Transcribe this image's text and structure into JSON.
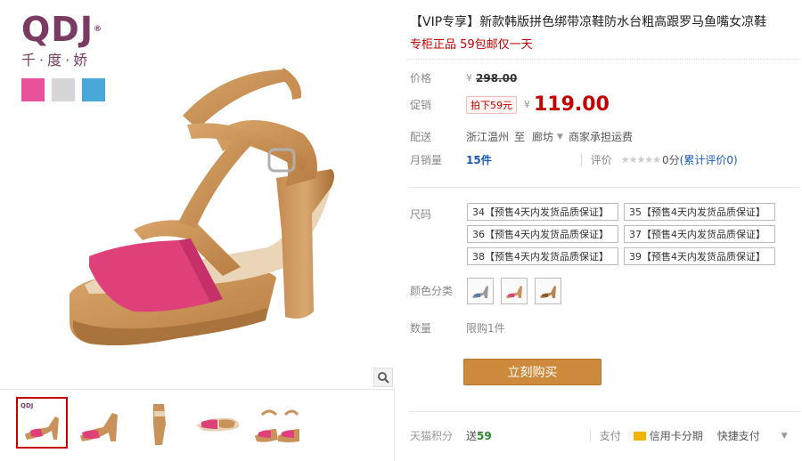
{
  "brand": {
    "logo": "QDJ",
    "reg_mark": "®",
    "tagline": "千·度·娇",
    "swatch_colors": [
      "#e8529a",
      "#d6d6d6",
      "#4aa8d8"
    ]
  },
  "gallery": {
    "zoom_icon": "magnifier-icon",
    "thumbnail_count": 5
  },
  "product": {
    "title": "【VIP专享】新款韩版拼色绑带凉鞋防水台粗高跟罗马鱼嘴女凉鞋",
    "subtitle": "专柜正品 59包邮仅一天"
  },
  "price": {
    "label": "价格",
    "currency": "¥",
    "original": "298.00",
    "promo_label": "促销",
    "promo_tag": "拍下59元",
    "promo_price": "119.00"
  },
  "shipping": {
    "label": "配送",
    "from": "浙江温州",
    "to_word": "至",
    "destination": "廊坊",
    "fee": "商家承担运费"
  },
  "sales": {
    "label": "月销量",
    "count": "15件",
    "rating_label": "评价",
    "stars": "★★★★★",
    "score": "0分",
    "review_count": "(累计评价0)"
  },
  "sizes": {
    "label": "尺码",
    "options": [
      "34【预售4天内发货品质保证】",
      "35【预售4天内发货品质保证】",
      "36【预售4天内发货品质保证】",
      "37【预售4天内发货品质保证】",
      "38【预售4天内发货品质保证】",
      "39【预售4天内发货品质保证】"
    ]
  },
  "colors": {
    "label": "颜色分类",
    "option_count": 3
  },
  "quantity": {
    "label": "数量",
    "limit": "限购1件"
  },
  "buy_button": "立刻购买",
  "footer": {
    "points_label": "天猫积分",
    "points_prefix": "送",
    "points_value": "59",
    "pay_label": "支付",
    "card_text": "信用卡分期",
    "quick_pay": "快捷支付"
  }
}
